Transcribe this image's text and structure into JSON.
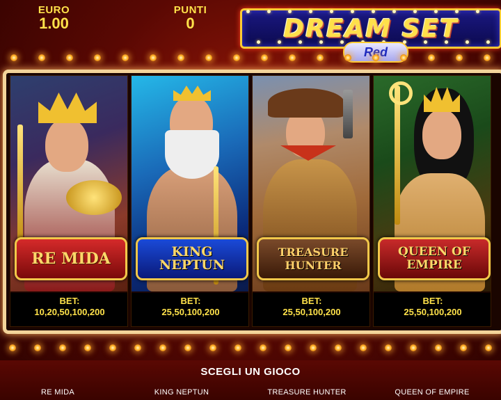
{
  "header": {
    "credit_label": "EURO",
    "credit_value": "1.00",
    "points_label": "PUNTI",
    "points_value": "0"
  },
  "logo": {
    "title": "DREAM SET",
    "subtitle": "Red"
  },
  "games": [
    {
      "name": "RE MIDA",
      "logo_text": "RE MIDA",
      "bet_label": "BET:",
      "bet_values": "10,20,50,100,200",
      "theme_color": "#d52a2a"
    },
    {
      "name": "KING NEPTUN",
      "logo_text": "KING NEPTUN",
      "bet_label": "BET:",
      "bet_values": "25,50,100,200",
      "theme_color": "#1a4ad8"
    },
    {
      "name": "TREASURE HUNTER",
      "logo_text": "TREASURE HUNTER",
      "bet_label": "BET:",
      "bet_values": "25,50,100,200",
      "theme_color": "#7a4a2a"
    },
    {
      "name": "QUEEN OF EMPIRE",
      "logo_text": "QUEEN OF EMPIRE",
      "bet_label": "BET:",
      "bet_values": "25,50,100,200",
      "theme_color": "#c82a2a"
    }
  ],
  "footer": {
    "prompt": "SCEGLI UN GIOCO"
  },
  "colors": {
    "accent_gold": "#ffe24a",
    "background_red": "#5a0803",
    "frame": "#f3d49a"
  }
}
